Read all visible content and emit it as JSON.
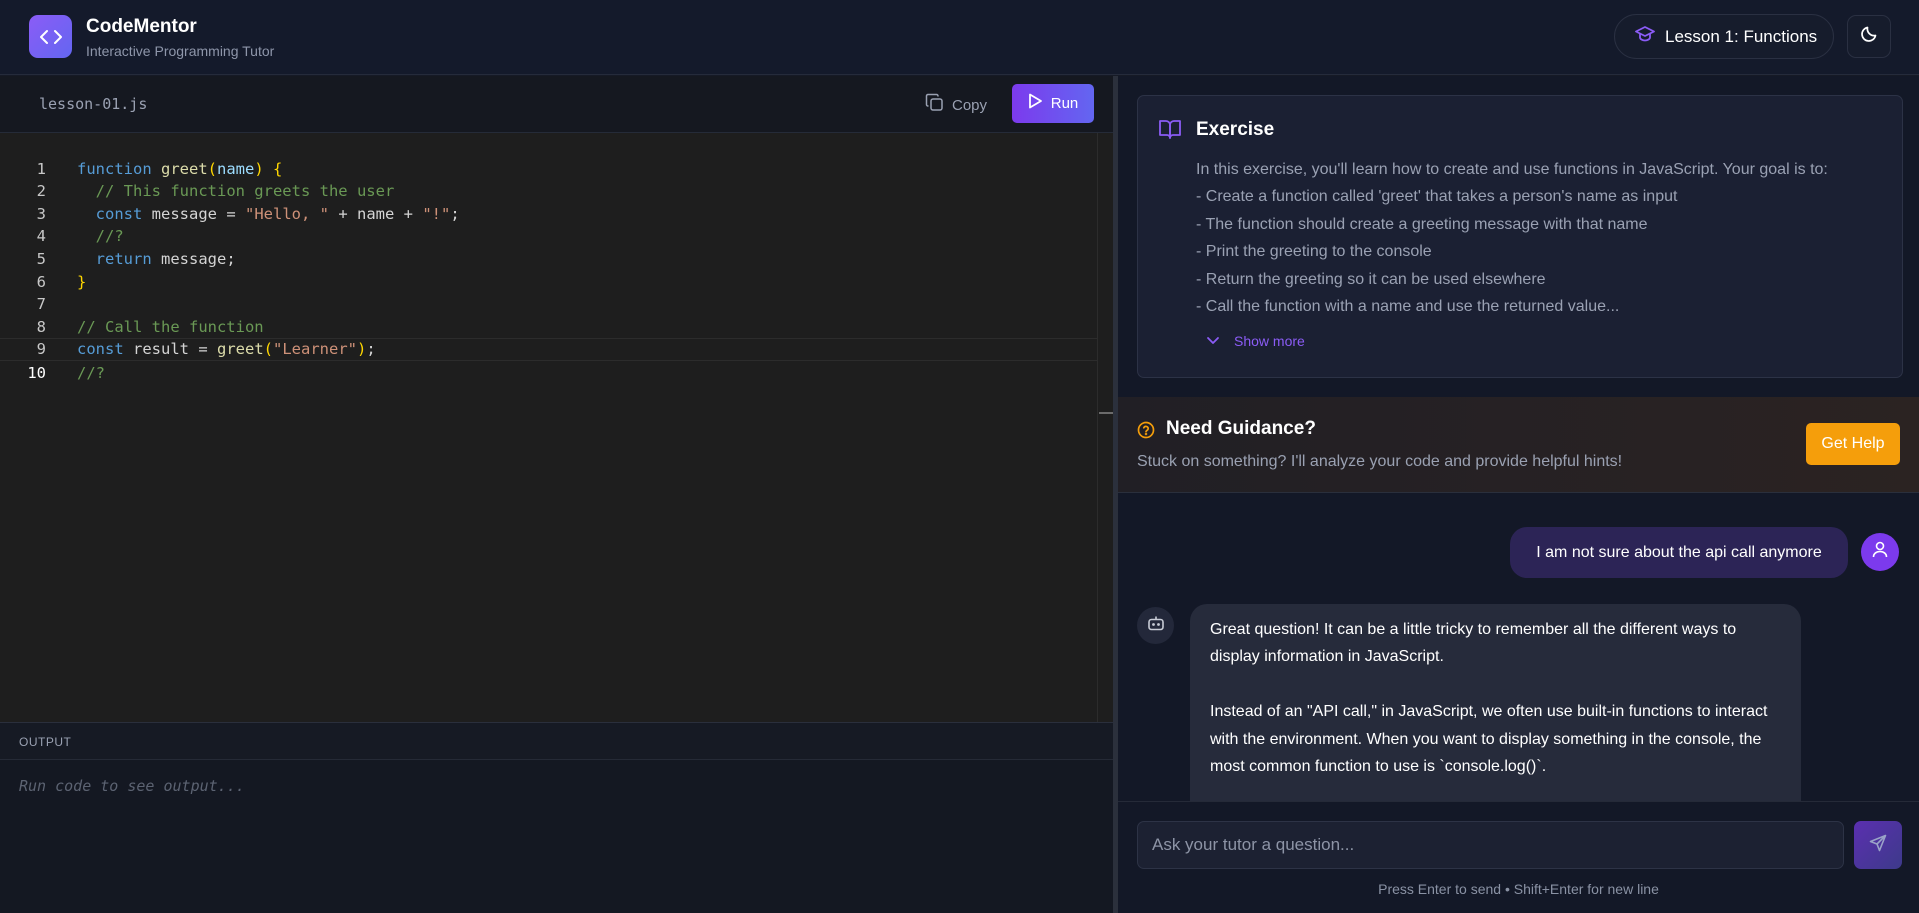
{
  "header": {
    "app_title": "CodeMentor",
    "app_subtitle": "Interactive Programming Tutor",
    "lesson_label": "Lesson 1: Functions",
    "logo_icon": "code-brackets-icon",
    "theme_icon": "moon-icon"
  },
  "editor": {
    "filename": "lesson-01.js",
    "copy_label": "Copy",
    "run_label": "Run",
    "active_line": 10,
    "lines": [
      "function greet(name) {",
      "  // This function greets the user",
      "  const message = \"Hello, \" + name + \"!\";",
      "  //?",
      "  return message;",
      "}",
      "",
      "// Call the function",
      "const result = greet(\"Learner\");",
      "//?"
    ]
  },
  "output": {
    "label": "OUTPUT",
    "placeholder": "Run code to see output..."
  },
  "exercise": {
    "title": "Exercise",
    "intro": "In this exercise, you'll learn how to create and use functions in JavaScript. Your goal is to:",
    "items": [
      "- Create a function called 'greet' that takes a person's name as input",
      "- The function should create a greeting message with that name",
      "- Print the greeting to the console",
      "- Return the greeting so it can be used elsewhere",
      "- Call the function with a name and use the returned value..."
    ],
    "show_more_label": "Show more"
  },
  "guidance": {
    "title": "Need Guidance?",
    "description": "Stuck on something? I'll analyze your code and provide helpful hints!",
    "button_label": "Get Help"
  },
  "chat": {
    "messages": [
      {
        "role": "user",
        "text": "I am not sure about the api call anymore"
      },
      {
        "role": "assistant",
        "paragraphs": [
          "Great question! It can be a little tricky to remember all the different ways to display information in JavaScript.",
          "Instead of an \"API call,\" in JavaScript, we often use built-in functions to interact with the environment. When you want to display something in the console, the most common function to use is `console.log()`."
        ]
      }
    ],
    "input_placeholder": "Ask your tutor a question...",
    "input_hint": "Press Enter to send • Shift+Enter for new line"
  },
  "colors": {
    "accent_purple": "#7c3aed",
    "accent_indigo": "#6366f1",
    "help_orange": "#f59e0b",
    "background": "#131827"
  }
}
